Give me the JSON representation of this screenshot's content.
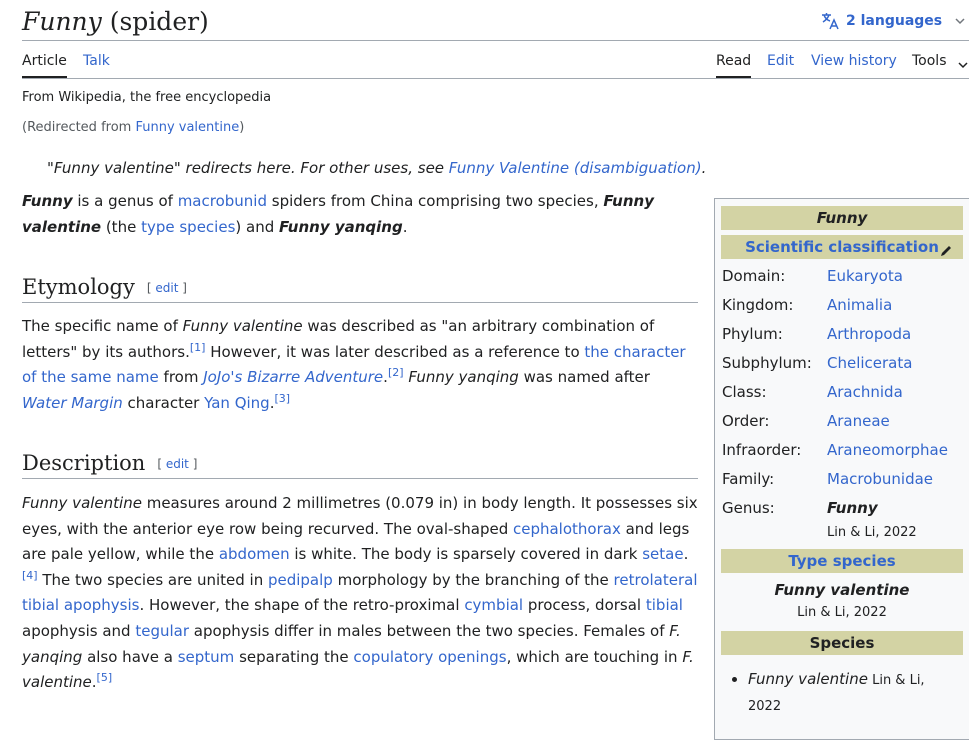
{
  "page": {
    "title_italic": "Funny",
    "title_rest": " (spider)",
    "languages": "2 languages"
  },
  "tabs": {
    "article": "Article",
    "talk": "Talk",
    "read": "Read",
    "edit": "Edit",
    "history": "View history",
    "tools": "Tools"
  },
  "tagline": "From Wikipedia, the free encyclopedia",
  "redirect": {
    "prefix": "(Redirected from ",
    "link": "Funny valentine",
    "suffix": ")"
  },
  "hatnote": {
    "q1": "\"",
    "term": "Funny valentine",
    "text": "\" redirects here. For other uses, see ",
    "link": "Funny Valentine (disambiguation)",
    "end": "."
  },
  "intro": {
    "t1": "Funny",
    "t2": " is a genus of ",
    "l1": "macrobunid",
    "t3": " spiders from China comprising two species, ",
    "t4": "Funny valentine",
    "t5": " (the ",
    "l2": "type species",
    "t6": ") and ",
    "t7": "Funny yanqing",
    "t8": "."
  },
  "etymology": {
    "heading": "Etymology",
    "edit": "[ edit ]",
    "t1": "The specific name of ",
    "i1": "Funny valentine",
    "t2": " was described as \"an arbitrary combination of letters\" by its authors.",
    "r1": "[1]",
    "t3": " However, it was later described as a reference to ",
    "l1": "the character of the same name",
    "t4": " from ",
    "l2": "JoJo's Bizarre Adventure",
    "t5": ".",
    "r2": "[2]",
    "t6": " ",
    "i2": "Funny yanqing",
    "t7": " was named after ",
    "l3": "Water Margin",
    "t8": " character ",
    "l4": "Yan Qing",
    "t9": ".",
    "r3": "[3]"
  },
  "description": {
    "heading": "Description",
    "edit": "[ edit ]",
    "i1": "Funny valentine",
    "t1": " measures around 2 millimetres (0.079 in) in body length. It possesses six eyes, with the anterior eye row being recurved. The oval-shaped ",
    "l1": "cephalothorax",
    "t2": " and legs are pale yellow, while the ",
    "l2": "abdomen",
    "t3": " is white. The body is sparsely covered in dark ",
    "l3": "setae",
    "t4": ".",
    "r1": "[4]",
    "t5": " The two species are united in ",
    "l4": "pedipalp",
    "t6": " morphology by the branching of the ",
    "l5": "retrolateral tibial apophysis",
    "t7": ". However, the shape of the retro-proximal ",
    "l6": "cymbial",
    "t8": " process, dorsal ",
    "l7": "tibial",
    "t9": " apophysis and ",
    "l8": "tegular",
    "t10": " apophysis differ in males between the two species. Females of ",
    "i2": "F. yanqing",
    "t11": " also have a ",
    "l9": "septum",
    "t12": " separating the ",
    "l10": "copulatory openings",
    "t13": ", which are touching in ",
    "i3": "F. valentine",
    "t14": ".",
    "r2": "[5]"
  },
  "infobox": {
    "title": "Funny",
    "sci": "Scientific classification",
    "rows": [
      {
        "k": "Domain:",
        "v": "Eukaryota"
      },
      {
        "k": "Kingdom:",
        "v": "Animalia"
      },
      {
        "k": "Phylum:",
        "v": "Arthropoda"
      },
      {
        "k": "Subphylum:",
        "v": "Chelicerata"
      },
      {
        "k": "Class:",
        "v": "Arachnida"
      },
      {
        "k": "Order:",
        "v": "Araneae"
      },
      {
        "k": "Infraorder:",
        "v": "Araneomorphae"
      },
      {
        "k": "Family:",
        "v": "Macrobunidae"
      }
    ],
    "genus_k": "Genus:",
    "genus_v": "Funny",
    "genus_auth": "Lin & Li, 2022",
    "type_head": "Type species",
    "type_name": "Funny valentine",
    "type_auth": "Lin & Li, 2022",
    "species_head": "Species",
    "sp1_name": "Funny valentine",
    "sp1_auth": " Lin & Li, 2022"
  }
}
